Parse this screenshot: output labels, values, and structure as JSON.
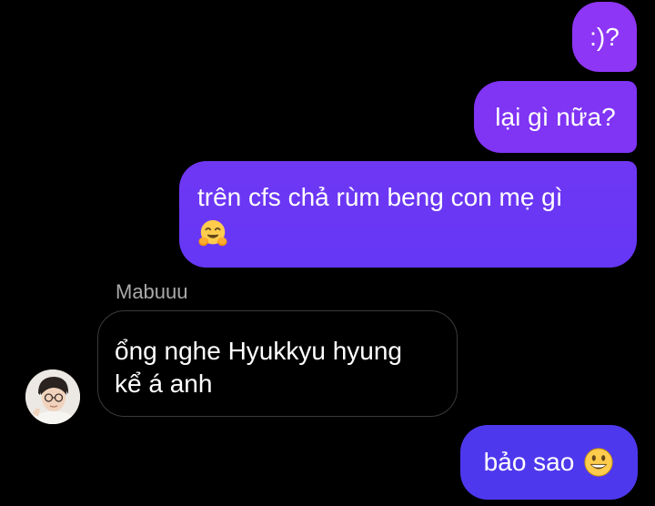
{
  "messages": [
    {
      "direction": "outgoing",
      "text": ":)?"
    },
    {
      "direction": "outgoing",
      "text": "lại gì nữa?"
    },
    {
      "direction": "outgoing",
      "text": "trên cfs chả rùm beng con mẹ gì",
      "emoji": "hugging-face-emoji"
    },
    {
      "direction": "incoming",
      "sender": "Mabuuu",
      "lines": [
        "ổng nghe Hyukkyu hyung",
        "kể á anh"
      ]
    },
    {
      "direction": "outgoing",
      "text": "bảo sao",
      "emoji": "grinning-face-emoji"
    }
  ],
  "colors": {
    "background": "#000000",
    "outgoing_bubble_top": "#8e36f5",
    "outgoing_bubble_bottom": "#4e38ee",
    "incoming_bubble_border": "#3a3a3a",
    "sender_name": "#a9a9a9",
    "text": "#ffffff"
  }
}
